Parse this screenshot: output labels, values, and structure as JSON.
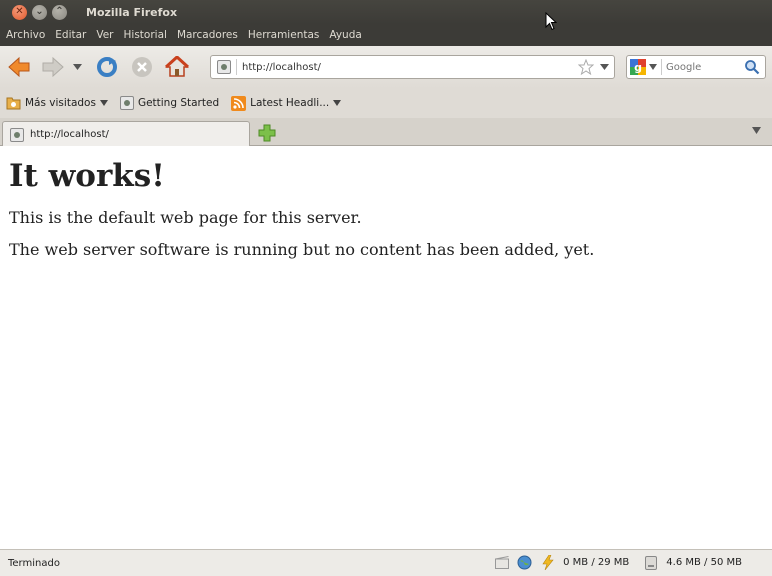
{
  "window": {
    "title": "Mozilla Firefox"
  },
  "menu": [
    "Archivo",
    "Editar",
    "Ver",
    "Historial",
    "Marcadores",
    "Herramientas",
    "Ayuda"
  ],
  "navbar": {
    "url": "http://localhost/",
    "search_placeholder": "Google",
    "icons": [
      "back-arrow-icon",
      "forward-arrow-icon",
      "reload-icon",
      "stop-icon",
      "home-icon",
      "bookmark-star-icon",
      "google-icon",
      "search-icon"
    ]
  },
  "bookmarks": {
    "items": [
      {
        "label": "Más visitados",
        "icon": "smart-folder-icon",
        "has_dropdown": true
      },
      {
        "label": "Getting Started",
        "icon": "page-icon",
        "has_dropdown": false
      },
      {
        "label": "Latest Headli...",
        "icon": "rss-icon",
        "has_dropdown": true
      }
    ]
  },
  "tabs": [
    {
      "label": "http://localhost/"
    }
  ],
  "page": {
    "heading": "It works!",
    "paragraphs": [
      "This is the default web page for this server.",
      "The web server software is running but no content has been added, yet."
    ]
  },
  "status": {
    "text": "Terminado",
    "memory": "0 MB / 29 MB",
    "storage": "4.6 MB / 50 MB"
  },
  "colors": {
    "close_button": "#e0582c",
    "titlebar": "#3c3b37",
    "toolbar": "#dfdbd5"
  }
}
